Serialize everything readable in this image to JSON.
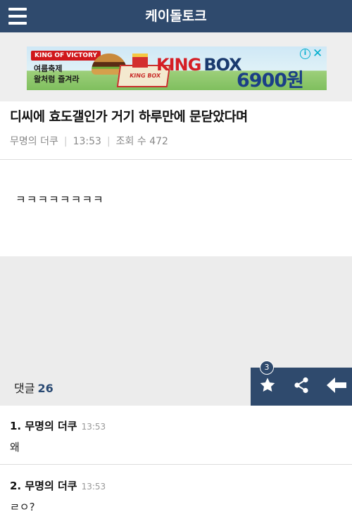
{
  "header": {
    "site_title": "케이돌토크",
    "menu_icon": "hamburger-menu-icon",
    "bg_color": "#2f4a6d"
  },
  "ad": {
    "badge": "KING OF VICTORY",
    "tagline_1": "여름축제",
    "tagline_2": "왈처럼 즐겨라",
    "box_label": "KING BOX",
    "brand_king": "KING",
    "brand_box": "BOX",
    "price": "6900원",
    "info_icon": "info-icon",
    "close_icon": "close-icon"
  },
  "post": {
    "title": "디씨에 효도갤인가 거기 하루만에 문닫았다며",
    "author": "무명의 더쿠",
    "time": "13:53",
    "views_label": "조회 수 472",
    "body": "ㅋㅋㅋㅋㅋㅋㅋㅋ"
  },
  "comment_bar": {
    "label": "댓글",
    "count": "26",
    "star_badge": "3",
    "icons": [
      "star-icon",
      "share-icon",
      "back-arrow-icon"
    ]
  },
  "comments": [
    {
      "index_author": "1. 무명의 더쿠",
      "time": "13:53",
      "body": "왜"
    },
    {
      "index_author": "2. 무명의 더쿠",
      "time": "13:53",
      "body": "ㄹㅇ?"
    }
  ]
}
